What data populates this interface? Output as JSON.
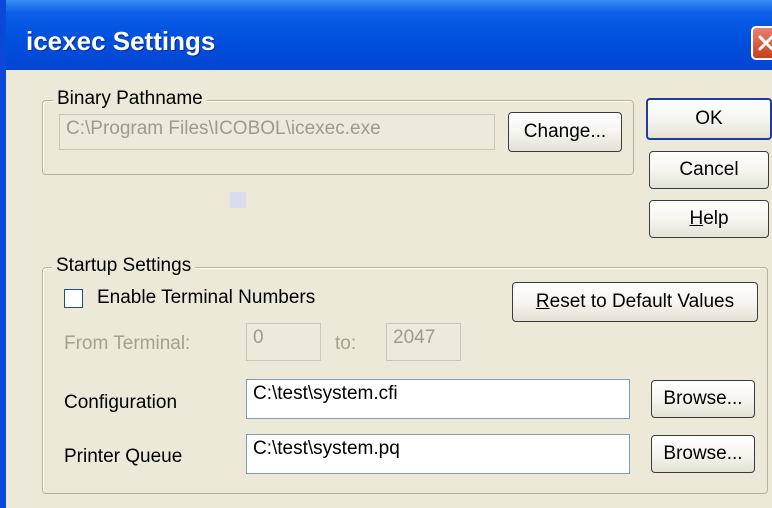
{
  "window": {
    "title": "icexec Settings"
  },
  "binary_group": {
    "label": "Binary Pathname",
    "path_value": "C:\\Program Files\\ICOBOL\\icexec.exe",
    "change_button": "Change..."
  },
  "buttons": {
    "ok": "OK",
    "cancel": "Cancel",
    "help_underlined": "H",
    "help_rest": "elp"
  },
  "startup_group": {
    "label": "Startup Settings",
    "enable_terminal_label": "Enable Terminal Numbers",
    "enable_terminal_checked": false,
    "reset_underlined": "R",
    "reset_rest": "eset to Default Values",
    "from_terminal_label": "From Terminal:",
    "from_terminal_value": "0",
    "to_label": "to:",
    "to_value": "2047",
    "configuration_label": "Configuration",
    "configuration_value": "C:\\test\\system.cfi",
    "configuration_browse": "Browse...",
    "printer_queue_label": "Printer Queue",
    "printer_queue_value": "C:\\test\\system.pq",
    "printer_queue_browse": "Browse..."
  },
  "colors": {
    "title_bar": "#0050de",
    "dialog_background": "#ece9d8",
    "close_button": "#d9583a"
  }
}
